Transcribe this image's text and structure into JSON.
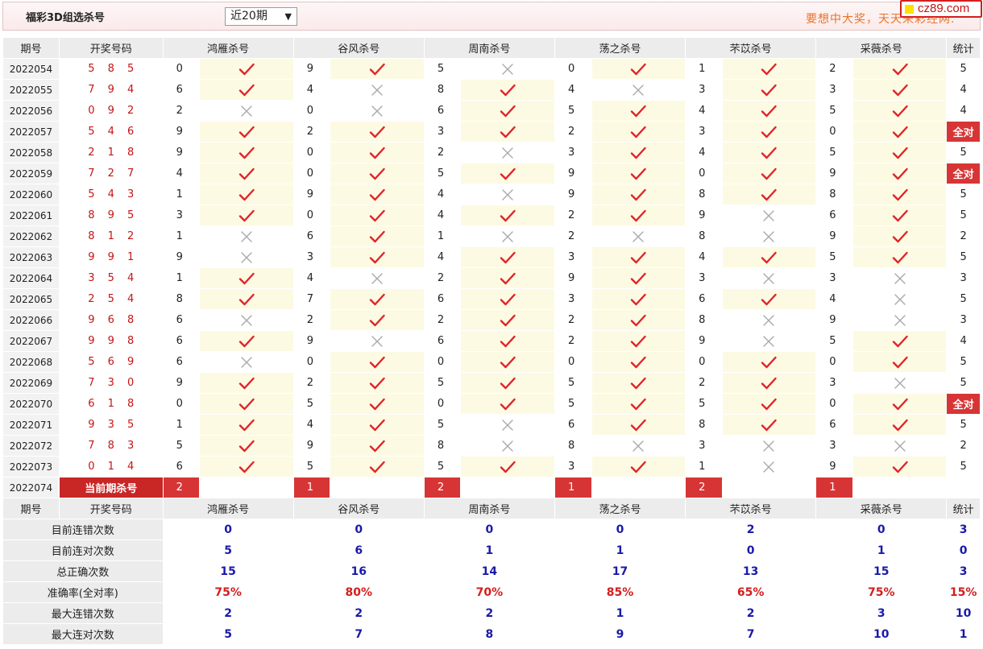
{
  "header": {
    "title": "福彩3D组选杀号",
    "period_select": "近20期",
    "slogan": "要想中大奖，天天来彩经网.",
    "logo": "cz89.com"
  },
  "columns": {
    "period": "期号",
    "draw": "开奖号码",
    "experts": [
      "鸿雁杀号",
      "谷风杀号",
      "周南杀号",
      "荡之杀号",
      "芣苡杀号",
      "采薇杀号"
    ],
    "stat": "统计"
  },
  "rows": [
    {
      "period": "2022054",
      "draw": "5 8 5",
      "picks": [
        {
          "n": "0",
          "ok": true
        },
        {
          "n": "9",
          "ok": true
        },
        {
          "n": "5",
          "ok": false
        },
        {
          "n": "0",
          "ok": true
        },
        {
          "n": "1",
          "ok": true
        },
        {
          "n": "2",
          "ok": true
        }
      ],
      "count": "5"
    },
    {
      "period": "2022055",
      "draw": "7 9 4",
      "picks": [
        {
          "n": "6",
          "ok": true
        },
        {
          "n": "4",
          "ok": false
        },
        {
          "n": "8",
          "ok": true
        },
        {
          "n": "4",
          "ok": false
        },
        {
          "n": "3",
          "ok": true
        },
        {
          "n": "3",
          "ok": true
        }
      ],
      "count": "4"
    },
    {
      "period": "2022056",
      "draw": "0 9 2",
      "picks": [
        {
          "n": "2",
          "ok": false
        },
        {
          "n": "0",
          "ok": false
        },
        {
          "n": "6",
          "ok": true
        },
        {
          "n": "5",
          "ok": true
        },
        {
          "n": "4",
          "ok": true
        },
        {
          "n": "5",
          "ok": true
        }
      ],
      "count": "4"
    },
    {
      "period": "2022057",
      "draw": "5 4 6",
      "picks": [
        {
          "n": "9",
          "ok": true
        },
        {
          "n": "2",
          "ok": true
        },
        {
          "n": "3",
          "ok": true
        },
        {
          "n": "2",
          "ok": true
        },
        {
          "n": "3",
          "ok": true
        },
        {
          "n": "0",
          "ok": true
        }
      ],
      "count": "全对"
    },
    {
      "period": "2022058",
      "draw": "2 1 8",
      "picks": [
        {
          "n": "9",
          "ok": true
        },
        {
          "n": "0",
          "ok": true
        },
        {
          "n": "2",
          "ok": false
        },
        {
          "n": "3",
          "ok": true
        },
        {
          "n": "4",
          "ok": true
        },
        {
          "n": "5",
          "ok": true
        }
      ],
      "count": "5"
    },
    {
      "period": "2022059",
      "draw": "7 2 7",
      "picks": [
        {
          "n": "4",
          "ok": true
        },
        {
          "n": "0",
          "ok": true
        },
        {
          "n": "5",
          "ok": true
        },
        {
          "n": "9",
          "ok": true
        },
        {
          "n": "0",
          "ok": true
        },
        {
          "n": "9",
          "ok": true
        }
      ],
      "count": "全对"
    },
    {
      "period": "2022060",
      "draw": "5 4 3",
      "picks": [
        {
          "n": "1",
          "ok": true
        },
        {
          "n": "9",
          "ok": true
        },
        {
          "n": "4",
          "ok": false
        },
        {
          "n": "9",
          "ok": true
        },
        {
          "n": "8",
          "ok": true
        },
        {
          "n": "8",
          "ok": true
        }
      ],
      "count": "5"
    },
    {
      "period": "2022061",
      "draw": "8 9 5",
      "picks": [
        {
          "n": "3",
          "ok": true
        },
        {
          "n": "0",
          "ok": true
        },
        {
          "n": "4",
          "ok": true
        },
        {
          "n": "2",
          "ok": true
        },
        {
          "n": "9",
          "ok": false
        },
        {
          "n": "6",
          "ok": true
        }
      ],
      "count": "5"
    },
    {
      "period": "2022062",
      "draw": "8 1 2",
      "picks": [
        {
          "n": "1",
          "ok": false
        },
        {
          "n": "6",
          "ok": true
        },
        {
          "n": "1",
          "ok": false
        },
        {
          "n": "2",
          "ok": false
        },
        {
          "n": "8",
          "ok": false
        },
        {
          "n": "9",
          "ok": true
        }
      ],
      "count": "2"
    },
    {
      "period": "2022063",
      "draw": "9 9 1",
      "picks": [
        {
          "n": "9",
          "ok": false
        },
        {
          "n": "3",
          "ok": true
        },
        {
          "n": "4",
          "ok": true
        },
        {
          "n": "3",
          "ok": true
        },
        {
          "n": "4",
          "ok": true
        },
        {
          "n": "5",
          "ok": true
        }
      ],
      "count": "5"
    },
    {
      "period": "2022064",
      "draw": "3 5 4",
      "picks": [
        {
          "n": "1",
          "ok": true
        },
        {
          "n": "4",
          "ok": false
        },
        {
          "n": "2",
          "ok": true
        },
        {
          "n": "9",
          "ok": true
        },
        {
          "n": "3",
          "ok": false
        },
        {
          "n": "3",
          "ok": false
        }
      ],
      "count": "3"
    },
    {
      "period": "2022065",
      "draw": "2 5 4",
      "picks": [
        {
          "n": "8",
          "ok": true
        },
        {
          "n": "7",
          "ok": true
        },
        {
          "n": "6",
          "ok": true
        },
        {
          "n": "3",
          "ok": true
        },
        {
          "n": "6",
          "ok": true
        },
        {
          "n": "4",
          "ok": false
        }
      ],
      "count": "5"
    },
    {
      "period": "2022066",
      "draw": "9 6 8",
      "picks": [
        {
          "n": "6",
          "ok": false
        },
        {
          "n": "2",
          "ok": true
        },
        {
          "n": "2",
          "ok": true
        },
        {
          "n": "2",
          "ok": true
        },
        {
          "n": "8",
          "ok": false
        },
        {
          "n": "9",
          "ok": false
        }
      ],
      "count": "3"
    },
    {
      "period": "2022067",
      "draw": "9 9 8",
      "picks": [
        {
          "n": "6",
          "ok": true
        },
        {
          "n": "9",
          "ok": false
        },
        {
          "n": "6",
          "ok": true
        },
        {
          "n": "2",
          "ok": true
        },
        {
          "n": "9",
          "ok": false
        },
        {
          "n": "5",
          "ok": true
        }
      ],
      "count": "4"
    },
    {
      "period": "2022068",
      "draw": "5 6 9",
      "picks": [
        {
          "n": "6",
          "ok": false
        },
        {
          "n": "0",
          "ok": true
        },
        {
          "n": "0",
          "ok": true
        },
        {
          "n": "0",
          "ok": true
        },
        {
          "n": "0",
          "ok": true
        },
        {
          "n": "0",
          "ok": true
        }
      ],
      "count": "5"
    },
    {
      "period": "2022069",
      "draw": "7 3 0",
      "picks": [
        {
          "n": "9",
          "ok": true
        },
        {
          "n": "2",
          "ok": true
        },
        {
          "n": "5",
          "ok": true
        },
        {
          "n": "5",
          "ok": true
        },
        {
          "n": "2",
          "ok": true
        },
        {
          "n": "3",
          "ok": false
        }
      ],
      "count": "5"
    },
    {
      "period": "2022070",
      "draw": "6 1 8",
      "picks": [
        {
          "n": "0",
          "ok": true
        },
        {
          "n": "5",
          "ok": true
        },
        {
          "n": "0",
          "ok": true
        },
        {
          "n": "5",
          "ok": true
        },
        {
          "n": "5",
          "ok": true
        },
        {
          "n": "0",
          "ok": true
        }
      ],
      "count": "全对"
    },
    {
      "period": "2022071",
      "draw": "9 3 5",
      "picks": [
        {
          "n": "1",
          "ok": true
        },
        {
          "n": "4",
          "ok": true
        },
        {
          "n": "5",
          "ok": false
        },
        {
          "n": "6",
          "ok": true
        },
        {
          "n": "8",
          "ok": true
        },
        {
          "n": "6",
          "ok": true
        }
      ],
      "count": "5"
    },
    {
      "period": "2022072",
      "draw": "7 8 3",
      "picks": [
        {
          "n": "5",
          "ok": true
        },
        {
          "n": "9",
          "ok": true
        },
        {
          "n": "8",
          "ok": false
        },
        {
          "n": "8",
          "ok": false
        },
        {
          "n": "3",
          "ok": false
        },
        {
          "n": "3",
          "ok": false
        }
      ],
      "count": "2"
    },
    {
      "period": "2022073",
      "draw": "0 1 4",
      "picks": [
        {
          "n": "6",
          "ok": true
        },
        {
          "n": "5",
          "ok": true
        },
        {
          "n": "5",
          "ok": true
        },
        {
          "n": "3",
          "ok": true
        },
        {
          "n": "1",
          "ok": false
        },
        {
          "n": "9",
          "ok": true
        }
      ],
      "count": "5"
    }
  ],
  "current": {
    "period": "2022074",
    "label": "当前期杀号",
    "picks": [
      "2",
      "1",
      "2",
      "1",
      "2",
      "1"
    ]
  },
  "stats": [
    {
      "label": "目前连错次数",
      "values": [
        "0",
        "0",
        "0",
        "0",
        "2",
        "0"
      ],
      "total": "3",
      "red": false
    },
    {
      "label": "目前连对次数",
      "values": [
        "5",
        "6",
        "1",
        "1",
        "0",
        "1"
      ],
      "total": "0",
      "red": false
    },
    {
      "label": "总正确次数",
      "values": [
        "15",
        "16",
        "14",
        "17",
        "13",
        "15"
      ],
      "total": "3",
      "red": false
    },
    {
      "label": "准确率(全对率)",
      "values": [
        "75%",
        "80%",
        "70%",
        "85%",
        "65%",
        "75%"
      ],
      "total": "15%",
      "red": true
    },
    {
      "label": "最大连错次数",
      "values": [
        "2",
        "2",
        "2",
        "1",
        "2",
        "3"
      ],
      "total": "10",
      "red": false
    },
    {
      "label": "最大连对次数",
      "values": [
        "5",
        "7",
        "8",
        "9",
        "7",
        "10"
      ],
      "total": "1",
      "red": false
    }
  ],
  "colors": {
    "check": "#e0242a",
    "cross": "#a9a9a9",
    "accent": "#d73535",
    "stat_blue": "#1a1aa8"
  },
  "icons": {
    "correct": "check-icon",
    "wrong": "cross-icon"
  }
}
